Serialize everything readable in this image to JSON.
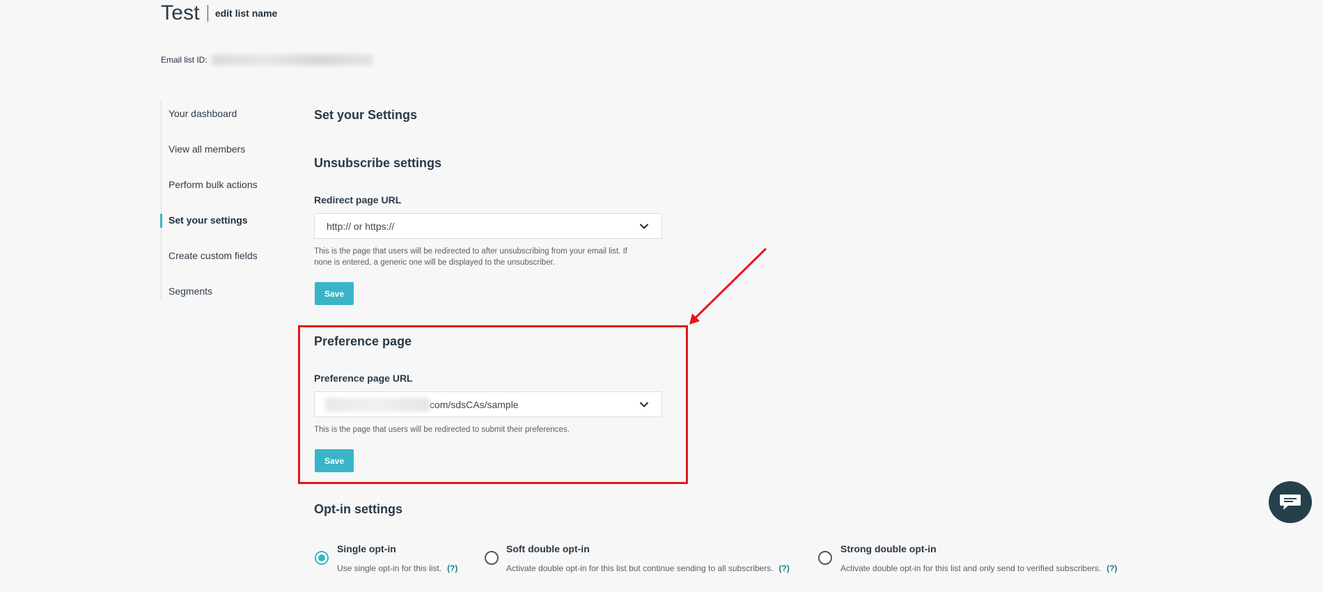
{
  "header": {
    "title": "Test",
    "edit_link": "edit list name",
    "list_id_label": "Email list ID:"
  },
  "sidebar": {
    "items": [
      {
        "label": "Your dashboard"
      },
      {
        "label": "View all members"
      },
      {
        "label": "Perform bulk actions"
      },
      {
        "label": "Set your settings",
        "active": true
      },
      {
        "label": "Create custom fields"
      },
      {
        "label": "Segments"
      }
    ]
  },
  "main": {
    "page_title": "Set your Settings",
    "unsubscribe": {
      "title": "Unsubscribe settings",
      "field_label": "Redirect page URL",
      "placeholder": "http:// or https://",
      "help": "This is the page that users will be redirected to after unsubscribing from your email list. If none is entered, a generic one will be displayed to the unsubscriber.",
      "save_label": "Save"
    },
    "preference": {
      "title": "Preference page",
      "field_label": "Preference page URL",
      "value_suffix": "com/sdsCAs/sample",
      "help": "This is the page that users will be redirected to submit their preferences.",
      "save_label": "Save"
    },
    "optin": {
      "title": "Opt-in settings",
      "help_link": "(?)",
      "options": [
        {
          "title": "Single opt-in",
          "desc": "Use single opt-in for this list.",
          "checked": true
        },
        {
          "title": "Soft double opt-in",
          "desc": "Activate double opt-in for this list but continue sending to all subscribers.",
          "checked": false
        },
        {
          "title": "Strong double opt-in",
          "desc": "Activate double opt-in for this list and only send to verified subscribers.",
          "checked": false
        }
      ]
    }
  },
  "colors": {
    "accent": "#3ab5c8",
    "annotation": "#e4161e",
    "chat_bg": "#25404a",
    "background": "#f7f7f7"
  },
  "icons": {
    "select_chevron": "chevron-down-icon",
    "chat": "chat-icon"
  }
}
